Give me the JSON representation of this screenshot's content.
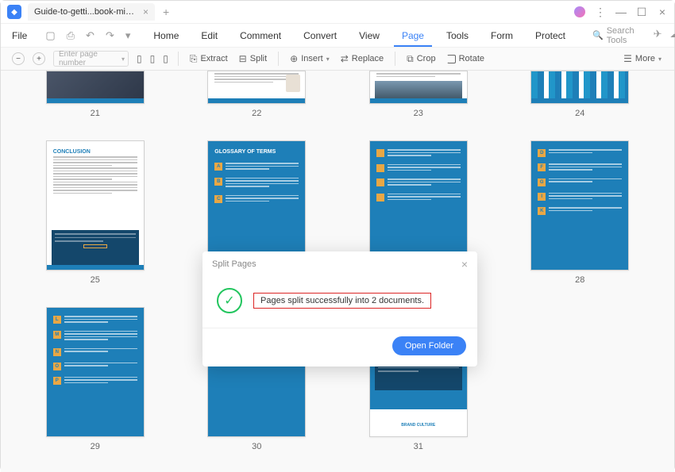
{
  "tab": {
    "title": "Guide-to-getti...book-min.pdf"
  },
  "menus": {
    "file": "File",
    "home": "Home",
    "edit": "Edit",
    "comment": "Comment",
    "convert": "Convert",
    "view": "View",
    "page": "Page",
    "tools": "Tools",
    "form": "Form",
    "protect": "Protect",
    "search_tools": "Search Tools"
  },
  "toolbar": {
    "page_placeholder": "Enter page number",
    "extract": "Extract",
    "split": "Split",
    "insert": "Insert",
    "replace": "Replace",
    "crop": "Crop",
    "rotate": "Rotate",
    "more": "More"
  },
  "pages": {
    "p21": "21",
    "p22": "22",
    "p23": "23",
    "p24": "24",
    "p25": "25",
    "p28": "28",
    "p29": "29",
    "p30": "30",
    "p31": "31"
  },
  "thumbs": {
    "conclusion": "CONCLUSION",
    "glossary": "GLOSSARY OF TERMS",
    "brand": "BRAND CULTURE"
  },
  "dialog": {
    "title": "Split Pages",
    "message": "Pages split successfully into 2 documents.",
    "open_folder": "Open Folder"
  }
}
